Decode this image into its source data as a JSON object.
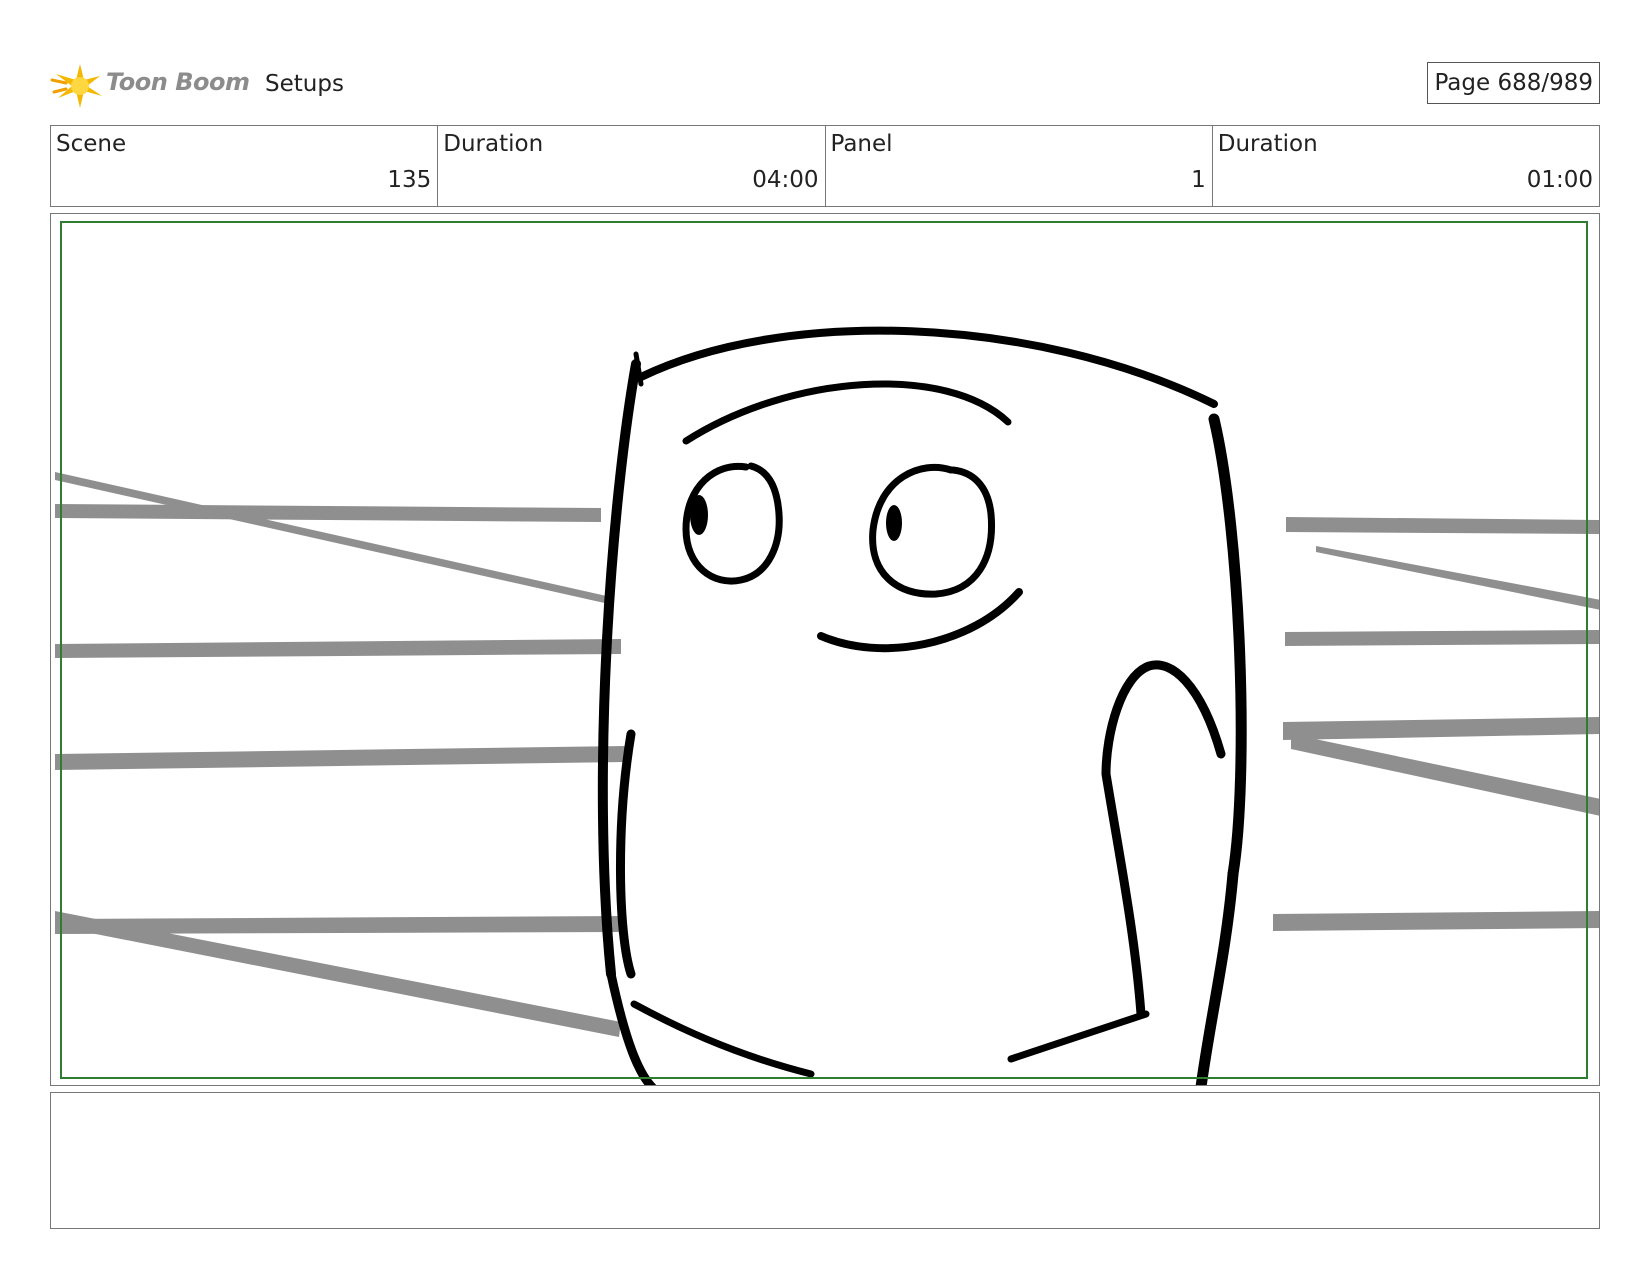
{
  "header": {
    "logo_text": "Toon Boom",
    "board_title": "Setups",
    "page_label": "Page 688/989"
  },
  "info": {
    "scene_label": "Scene",
    "scene_value": "135",
    "scene_duration_label": "Duration",
    "scene_duration_value": "04:00",
    "panel_label": "Panel",
    "panel_value": "1",
    "panel_duration_label": "Duration",
    "panel_duration_value": "01:00"
  },
  "panel": {
    "safe_frame_color": "#2e7d32",
    "speed_line_color": "#8f8f8f",
    "ink_color": "#000000"
  },
  "notes": {
    "text": ""
  }
}
